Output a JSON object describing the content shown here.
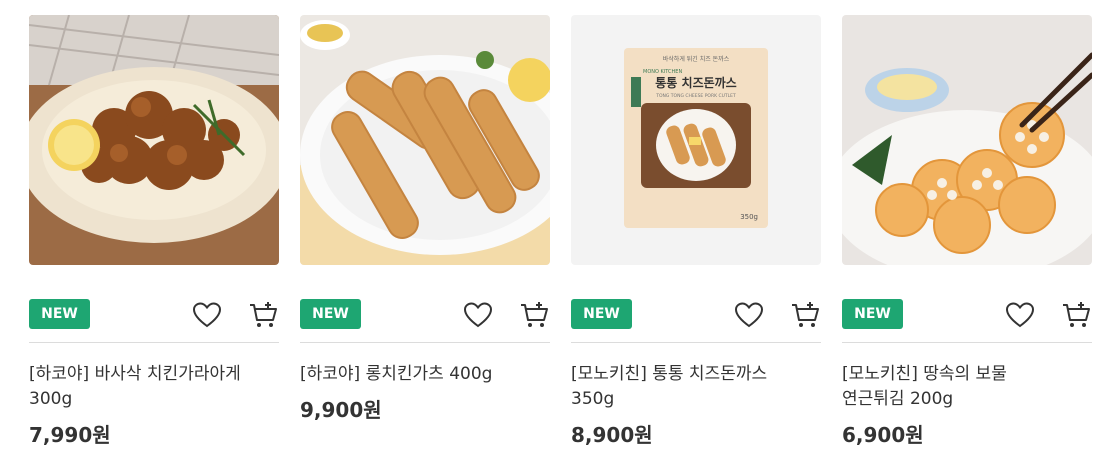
{
  "products": [
    {
      "badge": "NEW",
      "name": "[하코야] 바사삭 치킨가라아게\n300g",
      "price": "7,990원"
    },
    {
      "badge": "NEW",
      "name": "[하코야] 롱치킨가츠 400g",
      "price": "9,900원"
    },
    {
      "badge": "NEW",
      "name": "[모노키친] 통통 치즈돈까스\n350g",
      "price": "8,900원"
    },
    {
      "badge": "NEW",
      "name": "[모노키친] 땅속의 보물\n연근튀김 200g",
      "price": "6,900원"
    }
  ],
  "package": {
    "brand": "MONO KITCHEN",
    "tagline": "바삭하게 튀긴 치즈 돈까스",
    "title": "통통 치즈돈까스",
    "subtitle": "TONG TONG CHEESE PORK CUTLET",
    "weight": "350g"
  },
  "colors": {
    "badge": "#1ea672",
    "text": "#333333",
    "divider": "#dcdcdc"
  },
  "icons": {
    "wish": "heart-icon",
    "cart": "cart-icon"
  }
}
